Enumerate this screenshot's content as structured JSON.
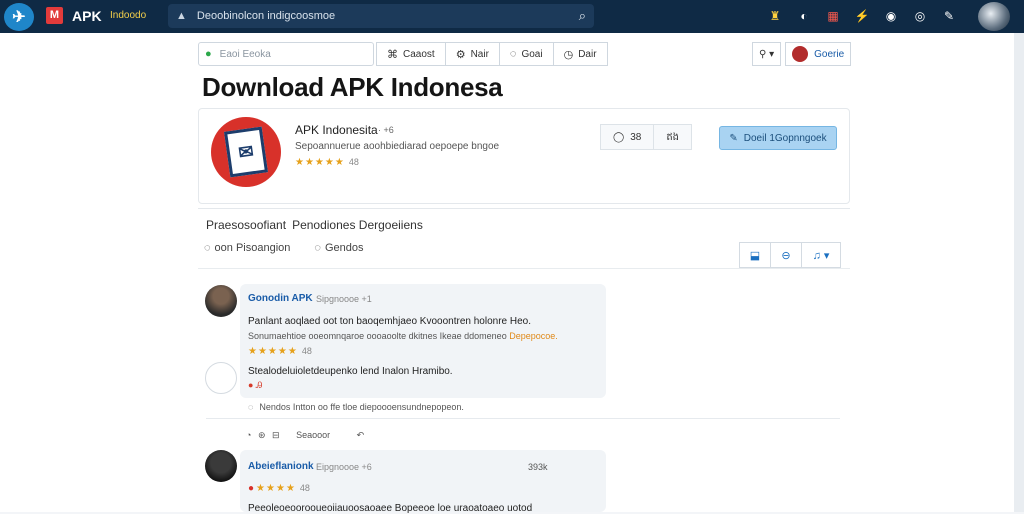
{
  "topbar": {
    "brand_mark": "M",
    "brand_name": "APK",
    "brand_sub": "Indoodo",
    "search_text": "Deoobinolcon indigcoosmoe",
    "icons": [
      "trophy-icon",
      "bell-icon",
      "apps-icon",
      "bolt-icon",
      "chat-icon",
      "globe-icon",
      "pen-icon"
    ]
  },
  "toolbar": {
    "search_placeholder": "Eaoi Eeoka",
    "buttons": [
      {
        "icon": "tag-icon",
        "label": "Caaost"
      },
      {
        "icon": "gear-icon",
        "label": "Nair"
      },
      {
        "icon": "comment-icon",
        "label": "Goai"
      },
      {
        "icon": "clock-icon",
        "label": "Dair"
      }
    ],
    "user_label": "Goerie"
  },
  "page": {
    "title": "Download APK Indonesa"
  },
  "app": {
    "name": "APK Indonesita",
    "version": "··  +6",
    "description": "Sepoannuerue aoohbiediarad oepoepe bngoe",
    "stars": "★★★★★",
    "rating_count": "48",
    "seg_left": "38",
    "seg_right": "ឥង",
    "download_label": "Doeil 1Gopnngoek"
  },
  "discussion": {
    "header_left": "Praesosoofiant",
    "header_right": "Penodiones Dergoeiiens",
    "tab_one": "oon Pisoangion",
    "tab_two": "Gendos"
  },
  "comments": [
    {
      "user": "Gonodin APK",
      "meta": "Sipgnoooe +1",
      "text": "Panlant aoqlaed oot ton baoqemhjaeo Kvooontren holonre Heo.",
      "sub": "Sonumaehtioe ooeomnqaroe oooaoolte dkitnes Ikeae ddomeneo",
      "sub_hl": "Depepocoe.",
      "stars": "★★★★★",
      "count": "48",
      "reply_text": "Stealodeluioletdeupenko lend Inalon Hramibo.",
      "reply_sub": "● Ꭿ",
      "foot": "Nendos Intton oo ffe tloe diepoooensundnepopeon."
    },
    {
      "user": "Abeieflanionk",
      "meta": "Eipgnoooe +6",
      "right": "393k",
      "stars": "★★★★",
      "count": "48",
      "text": "Peeoleoeoorooueoiiauoosaoaee Bopeeoe loe uraoatoaeo uotod"
    }
  ],
  "between": {
    "actions": "Seaooor"
  }
}
